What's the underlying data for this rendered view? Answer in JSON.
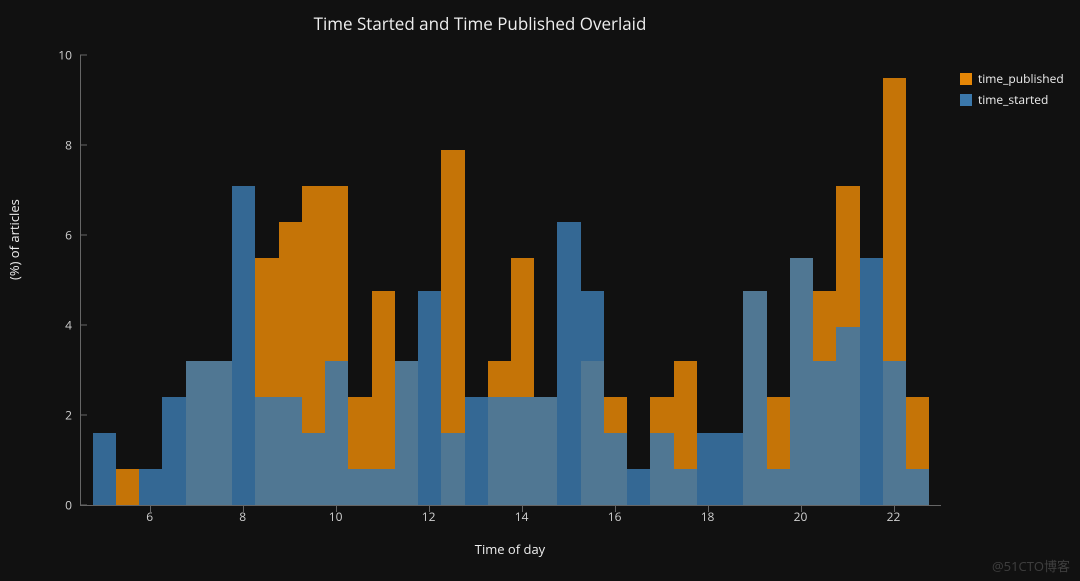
{
  "chart_data": {
    "type": "bar",
    "title": "Time Started and Time Published Overlaid",
    "xlabel": "Time of day",
    "ylabel": "(%) of articles",
    "ylim": [
      0,
      10
    ],
    "yticks": [
      0,
      2,
      4,
      6,
      8,
      10
    ],
    "xticks": [
      6,
      8,
      10,
      12,
      14,
      16,
      18,
      20,
      22
    ],
    "x_range": [
      5.0,
      22.5
    ],
    "bar_width": 0.5,
    "legend": {
      "position": "right",
      "entries": [
        {
          "name": "time_published",
          "color": "#e58606"
        },
        {
          "name": "time_started",
          "color": "#3b78ab"
        }
      ]
    },
    "categories": [
      5.0,
      5.5,
      6.0,
      6.5,
      7.0,
      7.5,
      8.0,
      8.5,
      9.0,
      9.5,
      10.0,
      10.5,
      11.0,
      11.5,
      12.0,
      12.5,
      13.0,
      13.5,
      14.0,
      14.5,
      15.0,
      15.5,
      16.0,
      16.5,
      17.0,
      17.5,
      18.0,
      18.5,
      19.0,
      19.5,
      20.0,
      20.5,
      21.0,
      21.5,
      22.0,
      22.5
    ],
    "series": [
      {
        "name": "time_published",
        "values": [
          0.0,
          0.8,
          0.0,
          0.0,
          3.2,
          3.2,
          0.0,
          5.5,
          6.3,
          7.1,
          7.1,
          2.4,
          4.75,
          3.2,
          0.0,
          7.9,
          0.0,
          3.2,
          5.5,
          2.4,
          0.0,
          3.2,
          2.4,
          0.0,
          2.4,
          3.2,
          0.0,
          0.0,
          4.75,
          2.4,
          5.5,
          4.75,
          7.1,
          0.0,
          9.5,
          2.4
        ]
      },
      {
        "name": "time_started",
        "values": [
          1.6,
          0.0,
          0.8,
          2.4,
          3.2,
          3.2,
          7.1,
          2.4,
          2.4,
          1.6,
          3.2,
          0.8,
          0.8,
          3.2,
          4.75,
          1.6,
          2.4,
          2.4,
          2.4,
          2.4,
          6.3,
          4.75,
          1.6,
          0.8,
          1.6,
          0.8,
          1.6,
          1.6,
          4.75,
          0.8,
          5.5,
          3.2,
          3.95,
          5.5,
          3.2,
          0.8
        ]
      }
    ]
  },
  "ui": {
    "watermark": "@51CTO博客"
  }
}
